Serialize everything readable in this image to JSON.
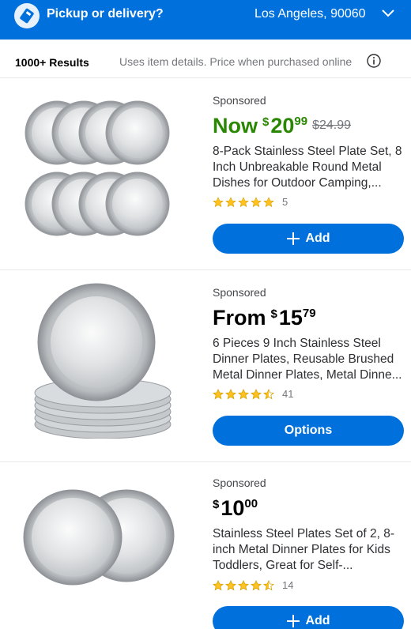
{
  "header": {
    "pickup_label": "Pickup or delivery?",
    "location": "Los Angeles, 90060"
  },
  "results": {
    "count": "1000+ Results",
    "note": "Uses item details. Price when purchased online"
  },
  "colors": {
    "brand_blue": "#0071dc",
    "now_green": "#2a8703",
    "star_yellow": "#ffc220"
  },
  "products": [
    {
      "sponsored": "Sponsored",
      "price_prefix": "Now",
      "price_dollars": "20",
      "price_cents": "99",
      "was_price": "$24.99",
      "title_line1": "8-Pack Stainless Steel Plate Set, 8",
      "title_line2": "Inch Unbreakable Round Metal",
      "title_line3": "Dishes for Outdoor Camping,...",
      "rating_stars": 5,
      "rating_count": "5",
      "button_label": "Add"
    },
    {
      "sponsored": "Sponsored",
      "price_prefix": "From",
      "price_dollars": "15",
      "price_cents": "79",
      "title_line1": "6 Pieces 9 Inch Stainless Steel",
      "title_line2": "Dinner Plates, Reusable Brushed",
      "title_line3": "Metal Dinner Plates, Metal Dinne...",
      "rating_stars": 4.5,
      "rating_count": "41",
      "button_label": "Options"
    },
    {
      "sponsored": "Sponsored",
      "price_dollars": "10",
      "price_cents": "00",
      "title_line1": "Stainless Steel Plates Set of 2, 8-",
      "title_line2": "inch Metal Dinner Plates for Kids",
      "title_line3": "Toddlers, Great for Self-...",
      "rating_stars": 4.5,
      "rating_count": "14",
      "button_label": "Add"
    }
  ]
}
